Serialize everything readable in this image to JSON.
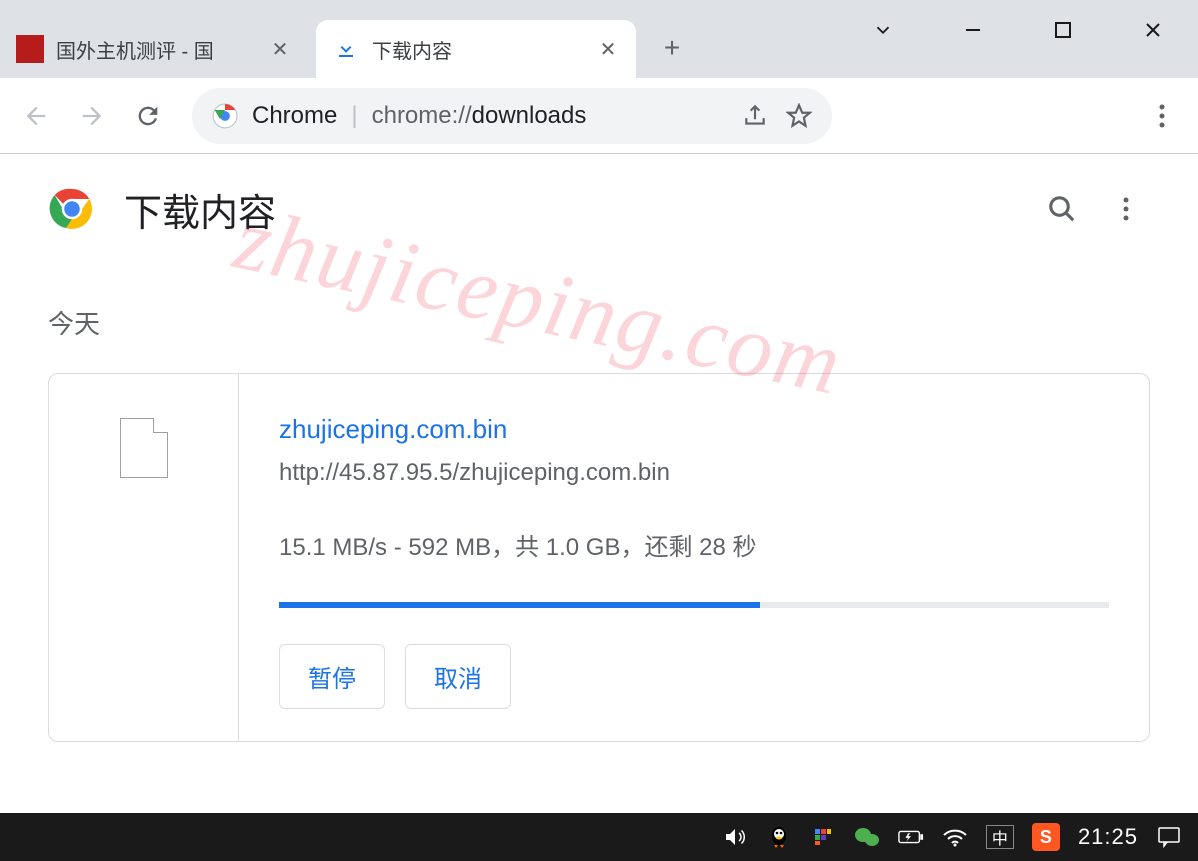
{
  "tabs": [
    {
      "title": "国外主机测评 - 国",
      "active": false
    },
    {
      "title": "下载内容",
      "active": true
    }
  ],
  "omnibox": {
    "scheme_label": "Chrome",
    "url_prefix": "chrome://",
    "url_bold": "downloads"
  },
  "page": {
    "title": "下载内容",
    "date_label": "今天"
  },
  "download": {
    "filename": "zhujiceping.com.bin",
    "url": "http://45.87.95.5/zhujiceping.com.bin",
    "status": "15.1 MB/s - 592 MB，共 1.0 GB，还剩 28 秒",
    "progress_percent": 58,
    "pause_label": "暂停",
    "cancel_label": "取消"
  },
  "watermark": "zhujiceping.com",
  "taskbar": {
    "ime": "中",
    "clock": "21:25"
  }
}
